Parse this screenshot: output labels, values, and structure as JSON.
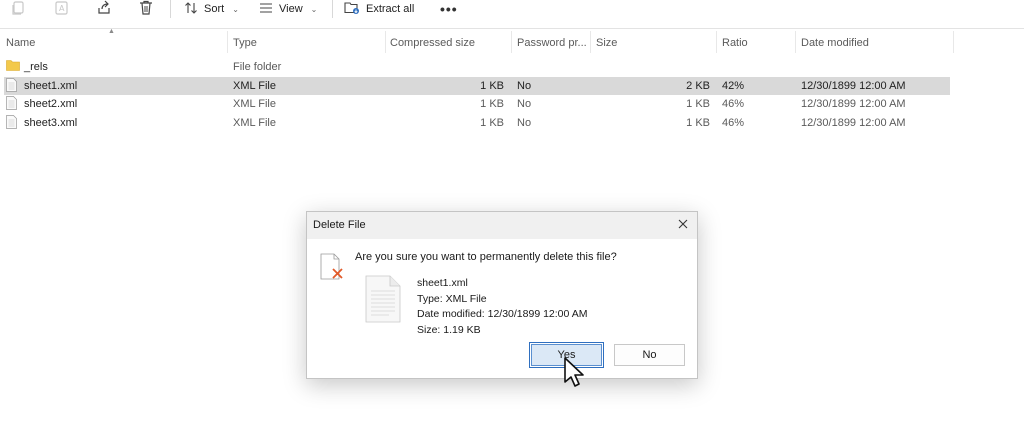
{
  "toolbar": {
    "sort_label": "Sort",
    "view_label": "View",
    "extract_label": "Extract all",
    "more_label": "•••"
  },
  "columns": [
    "Name",
    "Type",
    "Compressed size",
    "Password pr...",
    "Size",
    "Ratio",
    "Date modified"
  ],
  "files": [
    {
      "name": "_rels",
      "type": "File folder",
      "compressed": "",
      "password": "",
      "size": "",
      "ratio": "",
      "modified": "",
      "icon": "folder-icon"
    },
    {
      "name": "sheet1.xml",
      "type": "XML File",
      "compressed": "1 KB",
      "password": "No",
      "size": "2 KB",
      "ratio": "42%",
      "modified": "12/30/1899 12:00 AM",
      "icon": "file-icon"
    },
    {
      "name": "sheet2.xml",
      "type": "XML File",
      "compressed": "1 KB",
      "password": "No",
      "size": "1 KB",
      "ratio": "46%",
      "modified": "12/30/1899 12:00 AM",
      "icon": "file-icon"
    },
    {
      "name": "sheet3.xml",
      "type": "XML File",
      "compressed": "1 KB",
      "password": "No",
      "size": "1 KB",
      "ratio": "46%",
      "modified": "12/30/1899 12:00 AM",
      "icon": "file-icon"
    }
  ],
  "dialog": {
    "title": "Delete File",
    "question": "Are you sure you want to permanently delete this file?",
    "file_name": "sheet1.xml",
    "file_type": "Type: XML File",
    "file_modified": "Date modified: 12/30/1899 12:00 AM",
    "file_size": "Size: 1.19 KB",
    "yes_label": "Yes",
    "no_label": "No"
  },
  "colors": {
    "selection": "#d9d9d9",
    "accent": "#2f6fbf",
    "folder": "#f3c94b",
    "delete_x": "#e15a2a"
  }
}
